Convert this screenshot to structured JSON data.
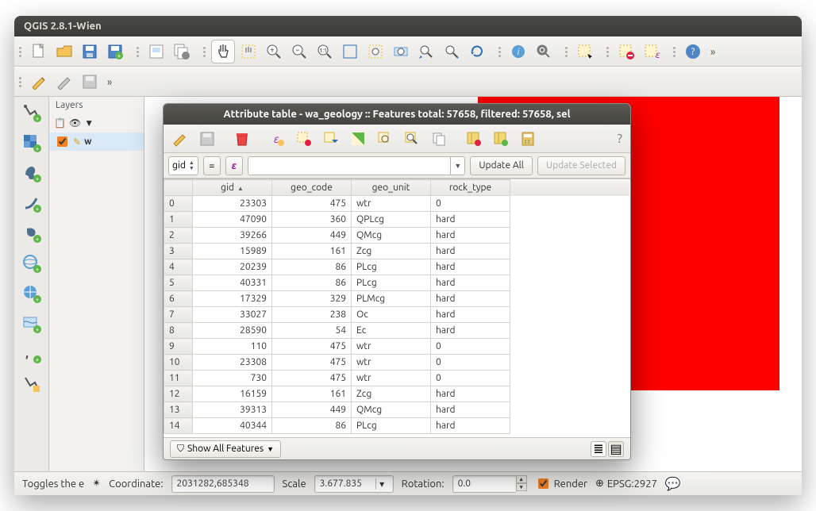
{
  "window": {
    "title": "QGIS 2.8.1-Wien"
  },
  "layers_panel": {
    "title": "Layers",
    "item_label": "w"
  },
  "dialog": {
    "title": "Attribute table - wa_geology :: Features total: 57658, filtered: 57658, sel",
    "field_select": "gid",
    "update_all": "Update All",
    "update_selected": "Update Selected",
    "show_all": "Show All Features",
    "columns": [
      "gid",
      "geo_code",
      "geo_unit",
      "rock_type"
    ],
    "rows": [
      {
        "idx": "0",
        "gid": "23303",
        "geo_code": "475",
        "geo_unit": "wtr",
        "rock_type": "0"
      },
      {
        "idx": "1",
        "gid": "47090",
        "geo_code": "360",
        "geo_unit": "QPLcg",
        "rock_type": "hard"
      },
      {
        "idx": "2",
        "gid": "39266",
        "geo_code": "449",
        "geo_unit": "QMcg",
        "rock_type": "hard"
      },
      {
        "idx": "3",
        "gid": "15989",
        "geo_code": "161",
        "geo_unit": "Zcg",
        "rock_type": "hard"
      },
      {
        "idx": "4",
        "gid": "20239",
        "geo_code": "86",
        "geo_unit": "PLcg",
        "rock_type": "hard"
      },
      {
        "idx": "5",
        "gid": "40331",
        "geo_code": "86",
        "geo_unit": "PLcg",
        "rock_type": "hard"
      },
      {
        "idx": "6",
        "gid": "17329",
        "geo_code": "329",
        "geo_unit": "PLMcg",
        "rock_type": "hard"
      },
      {
        "idx": "7",
        "gid": "33027",
        "geo_code": "238",
        "geo_unit": "Oc",
        "rock_type": "hard"
      },
      {
        "idx": "8",
        "gid": "28590",
        "geo_code": "54",
        "geo_unit": "Ec",
        "rock_type": "hard"
      },
      {
        "idx": "9",
        "gid": "110",
        "geo_code": "475",
        "geo_unit": "wtr",
        "rock_type": "0"
      },
      {
        "idx": "10",
        "gid": "23308",
        "geo_code": "475",
        "geo_unit": "wtr",
        "rock_type": "0"
      },
      {
        "idx": "11",
        "gid": "730",
        "geo_code": "475",
        "geo_unit": "wtr",
        "rock_type": "0"
      },
      {
        "idx": "12",
        "gid": "16159",
        "geo_code": "161",
        "geo_unit": "Zcg",
        "rock_type": "hard"
      },
      {
        "idx": "13",
        "gid": "39313",
        "geo_code": "449",
        "geo_unit": "QMcg",
        "rock_type": "hard"
      },
      {
        "idx": "14",
        "gid": "40344",
        "geo_code": "86",
        "geo_unit": "PLcg",
        "rock_type": "hard"
      }
    ]
  },
  "statusbar": {
    "hint": "Toggles the e",
    "coord_label": "Coordinate:",
    "coord_value": "2031282,685348",
    "scale_label": "Scale",
    "scale_value": "3.677.835",
    "rotation_label": "Rotation:",
    "rotation_value": "0.0",
    "render_label": "Render",
    "crs": "EPSG:2927"
  }
}
